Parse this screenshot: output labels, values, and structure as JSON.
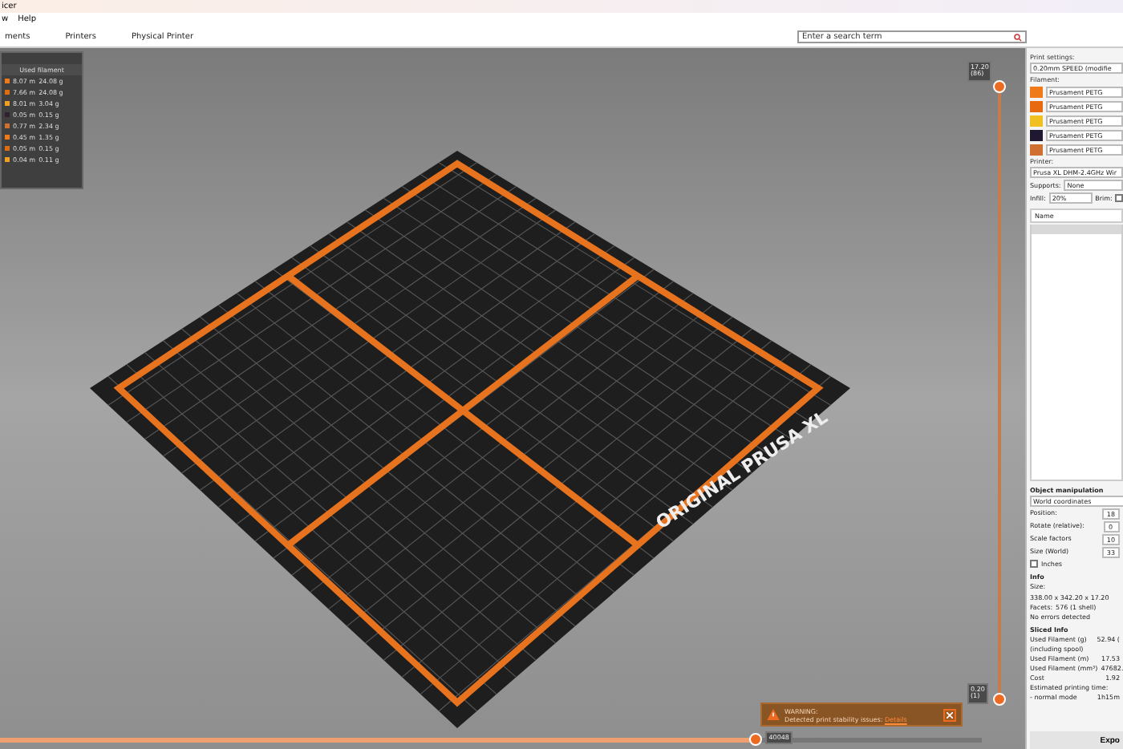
{
  "window": {
    "title": "icer"
  },
  "menu": [
    "w",
    "Help"
  ],
  "tabs": [
    {
      "label": "ments",
      "selected": false
    },
    {
      "label": "Printers",
      "selected": false
    },
    {
      "label": "Physical Printer",
      "selected": false
    }
  ],
  "search": {
    "placeholder": "Enter a search term"
  },
  "legend": {
    "header": "Used filament",
    "rows": [
      {
        "length": "8.07 m",
        "weight": "24.08 g",
        "color": "#f07a1a"
      },
      {
        "length": "7.66 m",
        "weight": "24.08 g",
        "color": "#e06c10"
      },
      {
        "length": "8.01 m",
        "weight": "3.04 g",
        "color": "#f0a020"
      },
      {
        "length": "0.05 m",
        "weight": "0.15 g",
        "color": "#302030"
      },
      {
        "length": "0.77 m",
        "weight": "2.34 g",
        "color": "#d07030"
      },
      {
        "length": "0.45 m",
        "weight": "1.35 g",
        "color": "#f07a1a"
      },
      {
        "length": "0.05 m",
        "weight": "0.15 g",
        "color": "#e06c10"
      },
      {
        "length": "0.04 m",
        "weight": "0.11 g",
        "color": "#f0a020"
      }
    ]
  },
  "bed": {
    "label": "ORIGINAL PRUSA XL"
  },
  "vertical_slider": {
    "top_label": "17.20",
    "top_sub": "(86)",
    "bottom_label": "0.20",
    "bottom_sub": "(1)",
    "level": 1
  },
  "horizontal_slider": {
    "label": "40048",
    "level": 0.77
  },
  "warning": {
    "title": "WARNING:",
    "text": "Detected print stability issues:",
    "link": "Details"
  },
  "sidebar": {
    "print_settings_label": "Print settings:",
    "print_settings": "0.20mm SPEED (modifie",
    "filament_label": "Filament:",
    "filaments": [
      {
        "name": "Prusament PETG",
        "color": "#f07a1a"
      },
      {
        "name": "Prusament PETG",
        "color": "#e86a10"
      },
      {
        "name": "Prusament PETG",
        "color": "#f0c020"
      },
      {
        "name": "Prusament PETG",
        "color": "#201830"
      },
      {
        "name": "Prusament PETG",
        "color": "#d07030"
      }
    ],
    "printer_label": "Printer:",
    "printer": "Prusa XL DHM-2.4GHz Wir",
    "supports_label": "Supports:",
    "supports": "None",
    "infill_label": "Infill:",
    "infill": "20%",
    "brim_label": "Brim:",
    "brim": false,
    "objects_header": "Name",
    "object_manipulation": {
      "title": "Object manipulation",
      "coordinates": "World coordinates",
      "rows": [
        {
          "label": "Position:",
          "value": "18"
        },
        {
          "label": "Rotate (relative):",
          "value": "0"
        },
        {
          "label": "Scale factors",
          "value": "10"
        },
        {
          "label": "Size (World)",
          "value": "33"
        }
      ],
      "inches_label": "Inches",
      "inches": false
    },
    "info": {
      "title": "Info",
      "rows": [
        {
          "label": "Size:",
          "value": "338.00 x 342.20 x 17.20"
        },
        {
          "label": "Facets:",
          "value": "576 (1 shell)"
        }
      ],
      "status": "No errors detected"
    },
    "sliced_info": {
      "title": "Sliced Info",
      "rows": [
        {
          "label": "Used Filament (g)",
          "value": "52.94 ("
        },
        {
          "label": "(including spool)",
          "value": ""
        },
        {
          "label": "Used Filament (m)",
          "value": "17.53"
        },
        {
          "label": "Used Filament (mm³)",
          "value": "47682."
        },
        {
          "label": "Cost",
          "value": "1.92"
        },
        {
          "label": "Estimated printing time:",
          "value": ""
        },
        {
          "label": "- normal mode",
          "value": "1h15m"
        }
      ]
    },
    "export_button": "Expo"
  }
}
